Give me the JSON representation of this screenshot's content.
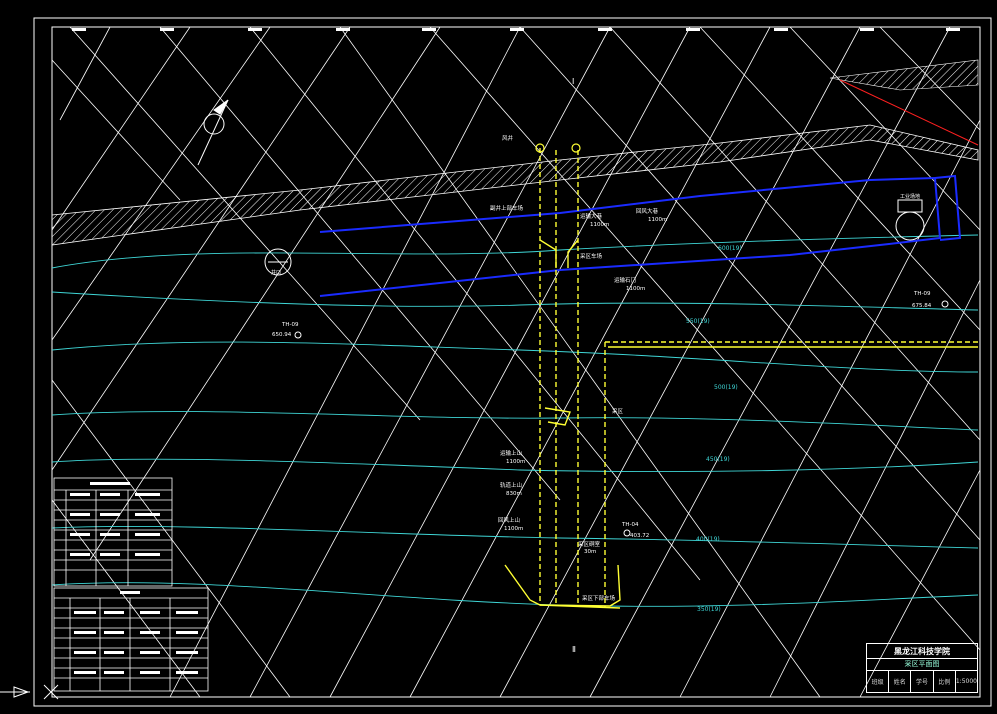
{
  "drawing": {
    "colors": {
      "background": "#000000",
      "frame": "#ffffff",
      "grid": "#ffffff",
      "contour": "#3fd6d6",
      "roadway_yellow": "#ffff33",
      "drift_blue": "#1a2bff",
      "boundary_red": "#ff2020"
    },
    "labels": {
      "shaft": "风井",
      "blue_drift_upper": "副井上部车场",
      "yellow_top_a": "运输大巷",
      "yellow_top_a_len": "1100m",
      "yellow_top_b": "回风大巷",
      "yellow_top_b_len": "1100m",
      "yellow_mid_a": "采区车场",
      "yellow_mid_b": "运输石门",
      "yellow_mid_b_len": "1100m",
      "center_label": "采区",
      "left_a": "运输上山",
      "left_a_len": "1100m",
      "left_b": "轨道上山",
      "left_b_len": "830m",
      "left_c": "回风上山",
      "left_c_len": "1100m",
      "bottom_a": "采区硐室",
      "bottom_a_len": "30m",
      "bottom_b": "采区下部车场",
      "right_box": "工业场地",
      "left_circle": "井口",
      "left_point_id": "TH-09",
      "left_point_elev": "650.94",
      "right_point_id": "TH-09",
      "right_point_elev": "675.84",
      "mid_point_id": "TH-04",
      "mid_point_elev": "403.72",
      "contours": [
        "600(19)",
        "550(19)",
        "500(19)",
        "450(19)",
        "400(19)",
        "350(19)"
      ],
      "top_marker": "Ⅰ",
      "bottom_marker": "Ⅱ"
    },
    "title_block": {
      "org": "黑龙江科技学院",
      "name": "采区平面图",
      "cells": [
        "班级",
        "姓名",
        "学号",
        "比例",
        "1:5000"
      ]
    }
  }
}
